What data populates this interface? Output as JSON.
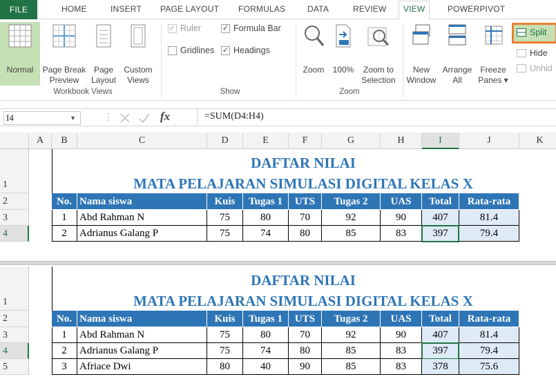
{
  "tabs": [
    "FILE",
    "HOME",
    "INSERT",
    "PAGE LAYOUT",
    "FORMULAS",
    "DATA",
    "REVIEW",
    "VIEW",
    "POWERPIVOT"
  ],
  "workbook_views": {
    "normal": "Normal",
    "page_break": [
      "Page Break",
      "Preview"
    ],
    "page_layout": [
      "Page",
      "Layout"
    ],
    "custom": [
      "Custom",
      "Views"
    ],
    "label": "Workbook Views"
  },
  "show": {
    "ruler": "Ruler",
    "formula_bar": "Formula Bar",
    "gridlines": "Gridlines",
    "headings": "Headings",
    "label": "Show"
  },
  "zoom": {
    "zoom": "Zoom",
    "hundred": "100%",
    "zoom_sel": [
      "Zoom to",
      "Selection"
    ],
    "label": "Zoom"
  },
  "window": {
    "new": [
      "New",
      "Window"
    ],
    "arrange": [
      "Arrange",
      "All"
    ],
    "freeze": [
      "Freeze",
      "Panes"
    ],
    "split": "Split",
    "hide": "Hide",
    "unhide": "Unhid"
  },
  "formula_bar": {
    "cell": "I4",
    "fx": "fx",
    "formula": "=SUM(D4:H4)"
  },
  "columns": [
    "A",
    "B",
    "C",
    "D",
    "E",
    "F",
    "G",
    "H",
    "I",
    "J",
    "K"
  ],
  "sheet": {
    "title1": "DAFTAR NILAI",
    "title2": "MATA PELAJARAN SIMULASI DIGITAL KELAS X",
    "headers": [
      "No.",
      "Nama siswa",
      "Kuis",
      "Tugas 1",
      "UTS",
      "Tugas 2",
      "UAS",
      "Total",
      "Rata-rata"
    ],
    "pane1_rows": [
      {
        "rownum": "3",
        "vals": [
          "1",
          "Abd Rahman N",
          "75",
          "80",
          "70",
          "92",
          "90",
          "407",
          "81.4"
        ]
      },
      {
        "rownum": "4",
        "vals": [
          "2",
          "Adrianus Galang P",
          "75",
          "74",
          "80",
          "85",
          "83",
          "397",
          "79.4"
        ]
      }
    ],
    "pane2_rows": [
      {
        "rownum": "3",
        "vals": [
          "1",
          "Abd Rahman N",
          "75",
          "80",
          "70",
          "92",
          "90",
          "407",
          "81.4"
        ]
      },
      {
        "rownum": "4",
        "vals": [
          "2",
          "Adrianus Galang P",
          "75",
          "74",
          "80",
          "85",
          "83",
          "397",
          "79.4"
        ]
      },
      {
        "rownum": "5",
        "vals": [
          "3",
          "Afriace Dwi",
          "80",
          "40",
          "90",
          "85",
          "83",
          "378",
          "75.6"
        ]
      }
    ],
    "rownums": {
      "r1": "1",
      "r2": "2"
    }
  },
  "colors": {
    "accent": "#217346",
    "header_fill": "#2e75b6",
    "total_fill": "#deebf7",
    "highlight": "#ed7d31"
  }
}
